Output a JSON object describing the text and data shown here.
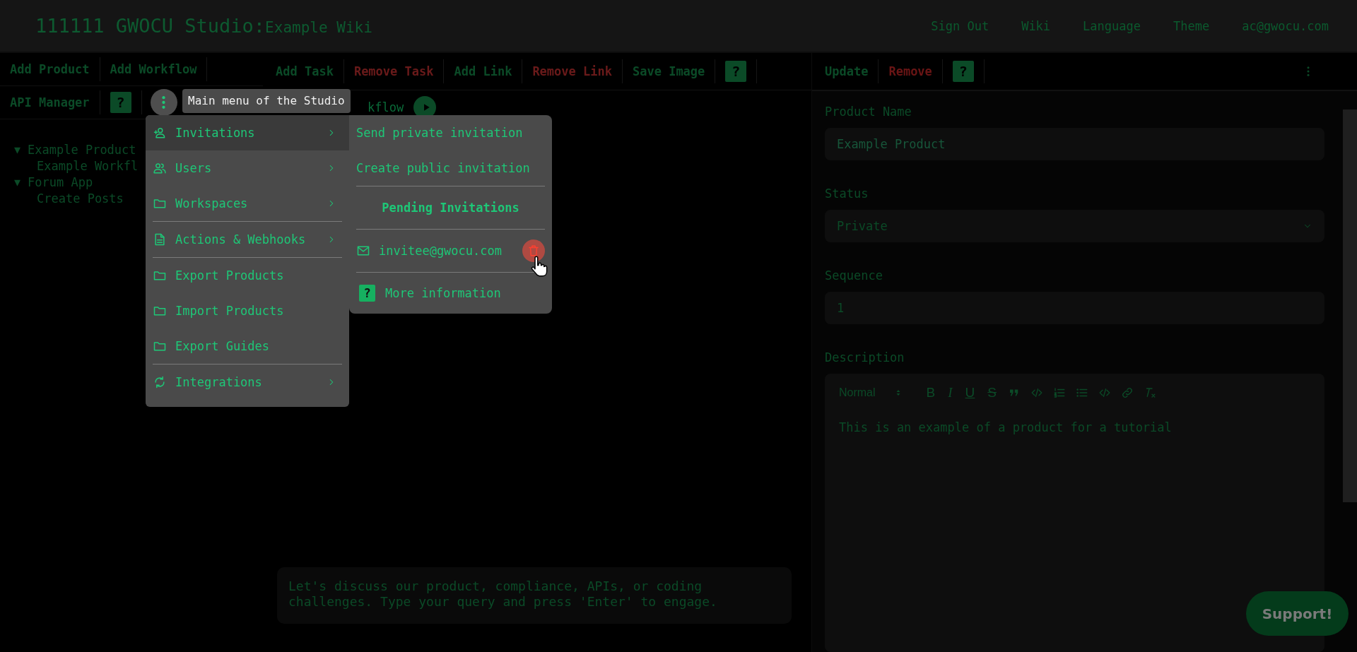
{
  "header": {
    "title": "111111 GWOCU Studio:",
    "subtitle": "Example Wiki",
    "links": [
      "Sign Out",
      "Wiki",
      "Language",
      "Theme",
      "ac@gwocu.com"
    ]
  },
  "left_toolbar": {
    "rows": [
      [
        {
          "kind": "text",
          "label": "Add Product"
        },
        {
          "kind": "text",
          "label": "Add Workflow"
        }
      ],
      [
        {
          "kind": "text",
          "label": "API Manager"
        },
        {
          "kind": "help",
          "label": "?"
        },
        {
          "kind": "kebab"
        }
      ]
    ]
  },
  "tree": [
    {
      "toggle": "▼",
      "label": "Example Product",
      "expanded": true,
      "children": [
        {
          "label": "Example Workfl"
        }
      ]
    },
    {
      "toggle": "▼",
      "label": "Forum App",
      "expanded": true,
      "children": [
        {
          "label": "Create Posts"
        }
      ]
    }
  ],
  "tooltip": "Main menu of the Studio",
  "main_menu": [
    {
      "kind": "user-add",
      "label": "Invitations",
      "submenu": true,
      "selected": true,
      "divider_before": false
    },
    {
      "kind": "users",
      "label": "Users",
      "submenu": true,
      "selected": false,
      "divider_before": false
    },
    {
      "kind": "folder",
      "label": "Workspaces",
      "submenu": true,
      "selected": false,
      "divider_before": false
    },
    {
      "kind": "document",
      "label": "Actions & Webhooks",
      "submenu": true,
      "selected": false,
      "divider_before": true
    },
    {
      "kind": "folder",
      "label": "Export Products",
      "submenu": false,
      "selected": false,
      "divider_before": true
    },
    {
      "kind": "folder",
      "label": "Import Products",
      "submenu": false,
      "selected": false,
      "divider_before": false
    },
    {
      "kind": "folder",
      "label": "Export Guides",
      "submenu": false,
      "selected": false,
      "divider_before": false
    },
    {
      "kind": "sync",
      "label": "Integrations",
      "submenu": true,
      "selected": false,
      "divider_before": true
    }
  ],
  "submenu": [
    {
      "kind": "action",
      "label": "Send private invitation"
    },
    {
      "kind": "action",
      "label": "Create public invitation"
    },
    {
      "kind": "heading",
      "label": "Pending Invitations"
    },
    {
      "kind": "invite",
      "label": "invitee@gwocu.com"
    },
    {
      "kind": "help",
      "glyph": "?",
      "label": "More information"
    }
  ],
  "middle_toolbar": [
    {
      "kind": "normal",
      "label": "Add Task"
    },
    {
      "kind": "danger",
      "label": "Remove Task"
    },
    {
      "kind": "normal",
      "label": "Add Link"
    },
    {
      "kind": "danger",
      "label": "Remove Link"
    },
    {
      "kind": "normal",
      "label": "Save Image"
    },
    {
      "kind": "help",
      "label": "?"
    }
  ],
  "workflow_title": "kflow",
  "chat": {
    "placeholder": "Let's discuss our product, compliance, APIs, or coding challenges. Type your query and press 'Enter' to engage."
  },
  "right_toolbar": [
    {
      "kind": "normal",
      "label": "Update"
    },
    {
      "kind": "danger",
      "label": "Remove"
    },
    {
      "kind": "help",
      "label": "?"
    }
  ],
  "form": [
    {
      "kind": "input",
      "label": "Product Name",
      "placeholder": "Example Product"
    },
    {
      "kind": "select",
      "label": "Status",
      "value": "Private"
    },
    {
      "kind": "input",
      "label": "Sequence",
      "value": "1"
    },
    {
      "kind": "editor",
      "label": "Description",
      "format": "Normal",
      "value": "This is an example of a product for a tutorial"
    }
  ],
  "editor_tools": [
    {
      "kind": "bold",
      "glyph": "B"
    },
    {
      "kind": "italic",
      "glyph": "I"
    },
    {
      "kind": "underline",
      "glyph": "U"
    },
    {
      "kind": "strike",
      "glyph": "S"
    },
    {
      "kind": "quote"
    },
    {
      "kind": "code"
    },
    {
      "kind": "ol"
    },
    {
      "kind": "ul"
    },
    {
      "kind": "code"
    },
    {
      "kind": "link"
    },
    {
      "kind": "clean"
    }
  ],
  "support_button": "Support!"
}
